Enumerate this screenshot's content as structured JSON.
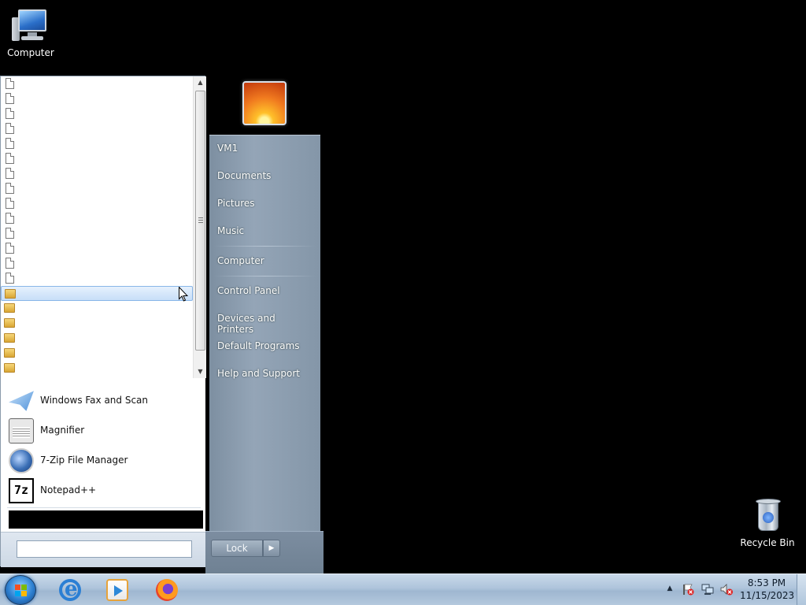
{
  "desktop": {
    "icons": [
      {
        "label": "Computer",
        "icon": "computer-icon"
      },
      {
        "label": "Recycle Bin",
        "icon": "recycle-bin-icon"
      }
    ]
  },
  "start_menu": {
    "programs_list": {
      "file_rows": 14,
      "folder_rows": 6,
      "selected_row_index": 14
    },
    "pinned_apps": [
      {
        "label": "Windows Fax and Scan",
        "icon": "fax-icon"
      },
      {
        "label": "Magnifier",
        "icon": "magnifier-icon"
      },
      {
        "label": "7-Zip File Manager",
        "icon": "7zip-icon"
      },
      {
        "label": "Notepad++",
        "icon": "notepad-plus-plus-icon",
        "glyph_text": "7z"
      }
    ],
    "search": {
      "value": "",
      "placeholder": ""
    },
    "right_items": [
      {
        "label": "VM1"
      },
      {
        "label": "Documents"
      },
      {
        "label": "Pictures"
      },
      {
        "label": "Music"
      },
      {
        "label": "Computer"
      },
      {
        "label": "Control Panel"
      },
      {
        "label": "Devices and Printers"
      },
      {
        "label": "Default Programs"
      },
      {
        "label": "Help and Support"
      }
    ],
    "lock_label": "Lock",
    "lock_arrow": "▶"
  },
  "taskbar": {
    "apps": [
      {
        "name": "Internet Explorer",
        "icon": "internet-explorer-icon"
      },
      {
        "name": "Windows Media Player",
        "icon": "media-player-icon"
      },
      {
        "name": "Firefox",
        "icon": "firefox-icon"
      }
    ],
    "tray_arrow": "▲",
    "clock": {
      "time": "8:53 PM",
      "date": "11/15/2023"
    }
  },
  "colors": {
    "desktop_background": "#000000",
    "taskbar": "#aec4db",
    "start_right_pane": "#8a9cae",
    "selection": "#c7def8"
  }
}
